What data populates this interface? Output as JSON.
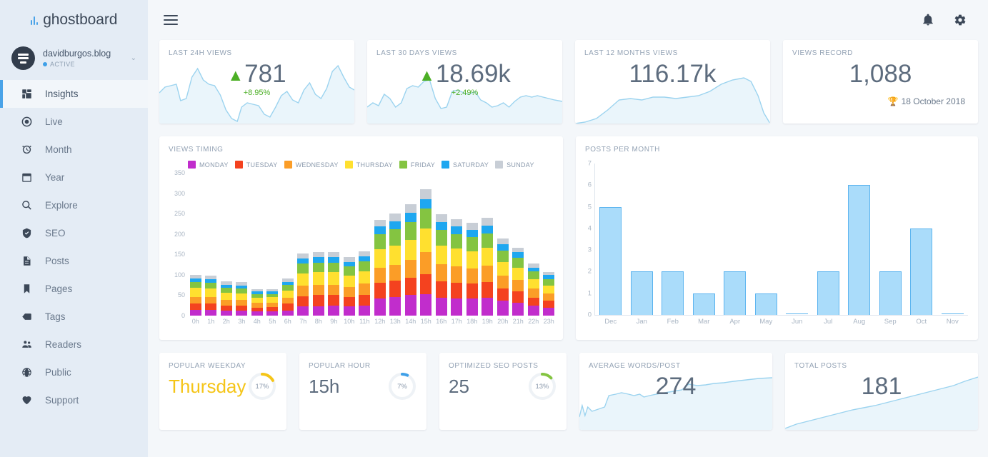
{
  "brand": {
    "name": "ghostboard",
    "logo_icon": "bar-chart-icon"
  },
  "account": {
    "name": "davidburgos.blog",
    "status": "ACTIVE",
    "chevron": "⌄",
    "avatar_icon": "site-avatar-icon"
  },
  "sidebar": {
    "items": [
      {
        "label": "Insights",
        "icon": "grid-icon",
        "active": true
      },
      {
        "label": "Live",
        "icon": "record-icon",
        "active": false
      },
      {
        "label": "Month",
        "icon": "alarm-clock-icon",
        "active": false
      },
      {
        "label": "Year",
        "icon": "calendar-icon",
        "active": false
      },
      {
        "label": "Explore",
        "icon": "search-icon",
        "active": false
      },
      {
        "label": "SEO",
        "icon": "shield-check-icon",
        "active": false
      },
      {
        "label": "Posts",
        "icon": "document-icon",
        "active": false
      },
      {
        "label": "Pages",
        "icon": "bookmark-icon",
        "active": false
      },
      {
        "label": "Tags",
        "icon": "tag-icon",
        "active": false
      },
      {
        "label": "Readers",
        "icon": "people-icon",
        "active": false
      },
      {
        "label": "Public",
        "icon": "globe-icon",
        "active": false
      },
      {
        "label": "Support",
        "icon": "heart-icon",
        "active": false
      }
    ]
  },
  "topbar": {
    "menu_icon": "hamburger-menu-icon",
    "notifications_icon": "bell-icon",
    "settings_icon": "gear-icon"
  },
  "colors": {
    "accent": "#4aa3e8",
    "positive": "#4caf25",
    "gold": "#f5c518",
    "sidebar_bg": "#e4ecf5",
    "page_bg": "#f4f7fa"
  },
  "stats": [
    {
      "title": "LAST 24H VIEWS",
      "value": "781",
      "delta": "+8.95%",
      "trend": "up",
      "trend_glyph": "▲"
    },
    {
      "title": "LAST 30 DAYS VIEWS",
      "value": "18.69k",
      "delta": "+2.49%",
      "trend": "up",
      "trend_glyph": "▲"
    },
    {
      "title": "LAST 12 MONTHS VIEWS",
      "value": "116.17k",
      "delta": "",
      "trend": "none",
      "trend_glyph": ""
    },
    {
      "title": "VIEWS RECORD",
      "value": "1,088",
      "date": "18 October 2018",
      "trophy_icon": "trophy-icon",
      "trophy_glyph": "🏆"
    }
  ],
  "bottom_cards": {
    "popular_weekday": {
      "title": "POPULAR WEEKDAY",
      "value": "Thursday",
      "pct": "17%",
      "pct_value": 17,
      "color": "#f5c518"
    },
    "popular_hour": {
      "title": "POPULAR HOUR",
      "value": "15h",
      "pct": "7%",
      "pct_value": 7,
      "color": "#3fa0e8"
    },
    "optimized_seo": {
      "title": "OPTIMIZED SEO POSTS",
      "value": "25",
      "pct": "13%",
      "pct_value": 13,
      "color": "#84c441"
    },
    "avg_words": {
      "title": "AVERAGE WORDS/POST",
      "value": "274"
    },
    "total_posts": {
      "title": "TOTAL POSTS",
      "value": "181"
    }
  },
  "chart_data": [
    {
      "type": "bar",
      "stacked": true,
      "title": "VIEWS TIMING",
      "xlabel": "",
      "ylabel": "",
      "ylim": [
        0,
        350
      ],
      "yticks": [
        0,
        50,
        100,
        150,
        200,
        250,
        300,
        350
      ],
      "grid": false,
      "legend_position": "top",
      "categories": [
        "0h",
        "1h",
        "2h",
        "3h",
        "4h",
        "5h",
        "6h",
        "7h",
        "8h",
        "9h",
        "10h",
        "11h",
        "12h",
        "13h",
        "14h",
        "15h",
        "16h",
        "17h",
        "18h",
        "19h",
        "20h",
        "21h",
        "22h",
        "23h"
      ],
      "series": [
        {
          "name": "MONDAY",
          "color": "#c12dcc",
          "values": [
            14,
            14,
            12,
            13,
            10,
            10,
            13,
            22,
            23,
            25,
            22,
            25,
            42,
            45,
            50,
            52,
            44,
            42,
            42,
            44,
            36,
            32,
            24,
            20
          ]
        },
        {
          "name": "TUESDAY",
          "color": "#f4421f",
          "values": [
            16,
            15,
            13,
            12,
            10,
            11,
            16,
            25,
            27,
            26,
            24,
            26,
            38,
            40,
            42,
            50,
            40,
            38,
            36,
            38,
            30,
            28,
            20,
            16
          ]
        },
        {
          "name": "WEDNESDAY",
          "color": "#fb9d27",
          "values": [
            16,
            16,
            14,
            13,
            11,
            11,
            15,
            26,
            26,
            25,
            24,
            28,
            38,
            40,
            44,
            54,
            42,
            40,
            38,
            40,
            32,
            28,
            22,
            18
          ]
        },
        {
          "name": "THURSDAY",
          "color": "#ffe02f",
          "values": [
            22,
            21,
            17,
            16,
            13,
            13,
            18,
            30,
            30,
            30,
            28,
            30,
            44,
            46,
            50,
            58,
            46,
            44,
            42,
            44,
            34,
            30,
            24,
            20
          ]
        },
        {
          "name": "FRIDAY",
          "color": "#84c441",
          "values": [
            14,
            14,
            12,
            12,
            9,
            8,
            13,
            24,
            24,
            24,
            22,
            24,
            38,
            40,
            44,
            48,
            38,
            36,
            34,
            36,
            28,
            24,
            18,
            16
          ]
        },
        {
          "name": "SATURDAY",
          "color": "#1ea7f0",
          "values": [
            9,
            9,
            8,
            8,
            6,
            6,
            8,
            13,
            13,
            13,
            12,
            13,
            18,
            20,
            22,
            24,
            20,
            19,
            18,
            19,
            15,
            13,
            10,
            9
          ]
        },
        {
          "name": "SUNDAY",
          "color": "#c8ced6",
          "values": [
            9,
            9,
            8,
            8,
            6,
            6,
            8,
            12,
            12,
            12,
            11,
            12,
            17,
            19,
            21,
            23,
            19,
            18,
            17,
            18,
            14,
            12,
            10,
            8
          ]
        }
      ]
    },
    {
      "type": "bar",
      "stacked": false,
      "title": "POSTS PER MONTH",
      "xlabel": "",
      "ylabel": "",
      "ylim": [
        0,
        7
      ],
      "yticks": [
        0,
        1,
        2,
        3,
        4,
        5,
        6,
        7
      ],
      "grid": false,
      "bar_fill": "#aadcfa",
      "bar_stroke": "#5cb4ef",
      "categories": [
        "Dec",
        "Jan",
        "Feb",
        "Mar",
        "Apr",
        "May",
        "Jun",
        "Jul",
        "Aug",
        "Sep",
        "Oct",
        "Nov"
      ],
      "values": [
        5,
        2,
        2,
        1,
        2,
        1,
        0,
        2,
        6,
        2,
        4,
        0
      ]
    }
  ]
}
